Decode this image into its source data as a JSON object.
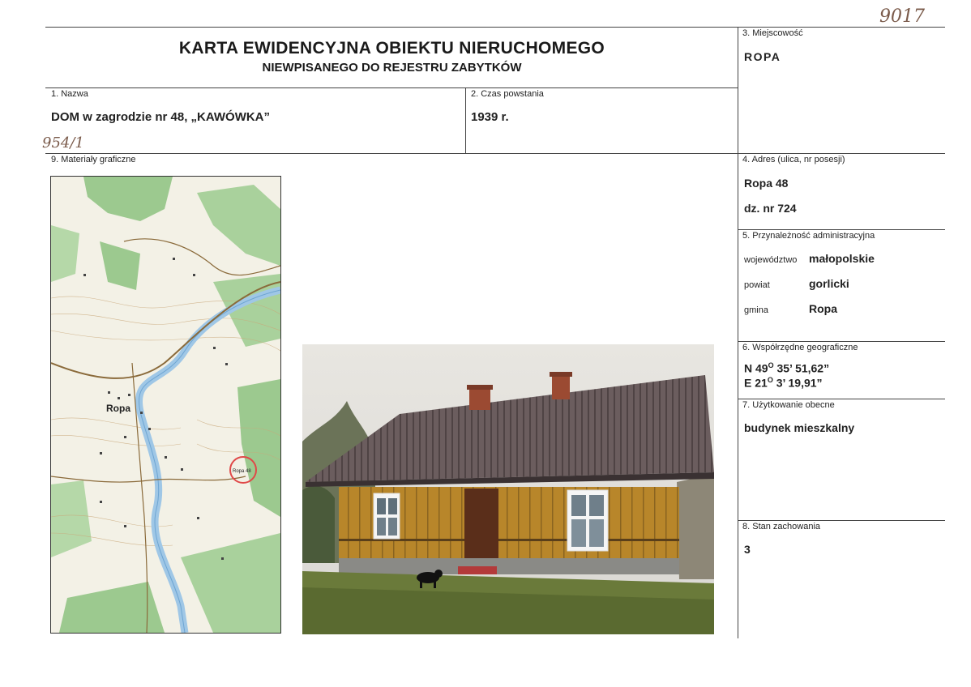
{
  "header": {
    "title": "KARTA EWIDENCYJNA OBIEKTU NIERUCHOMEGO",
    "subtitle": "NIEWPISANEGO DO REJESTRU ZABYTKÓW",
    "handwritten_number": "9017"
  },
  "field_1": {
    "label": "1. Nazwa",
    "value": "DOM w zagrodzie nr 48, „KAWÓWKA”"
  },
  "field_2": {
    "label": "2. Czas powstania",
    "value": "1939 r."
  },
  "field_3": {
    "label": "3. Miejscowość",
    "value": "ROPA"
  },
  "field_4": {
    "label": "4. Adres (ulica, nr posesji)",
    "line1": "Ropa 48",
    "line2": "dz. nr 724"
  },
  "field_5": {
    "label": "5. Przynależność administracyjna",
    "wojewodztwo_label": "województwo",
    "wojewodztwo": "małopolskie",
    "powiat_label": "powiat",
    "powiat": "gorlicki",
    "gmina_label": "gmina",
    "gmina": "Ropa"
  },
  "field_6": {
    "label": "6. Współrzędne geograficzne",
    "n_prefix": "N 49",
    "n_deg": "O",
    "n_rest": " 35’ 51,62”",
    "e_prefix": "E 21",
    "e_deg": "O",
    "e_rest": " 3’ 19,91”"
  },
  "field_7": {
    "label": "7. Użytkowanie obecne",
    "value": "budynek mieszkalny"
  },
  "field_8": {
    "label": "8. Stan zachowania",
    "value": "3"
  },
  "field_9": {
    "label": "9. Materiały graficzne",
    "handwritten_number": "954/1"
  },
  "map": {
    "town_label": "Ropa",
    "pin_label": "Ropa 48"
  },
  "colors": {
    "map_green": "#9cc98f",
    "map_bg": "#f3f1e6",
    "river": "#9fc7e6",
    "marker": "#e04848",
    "wall": "#b8862a",
    "roof": "#6a5a5a"
  }
}
